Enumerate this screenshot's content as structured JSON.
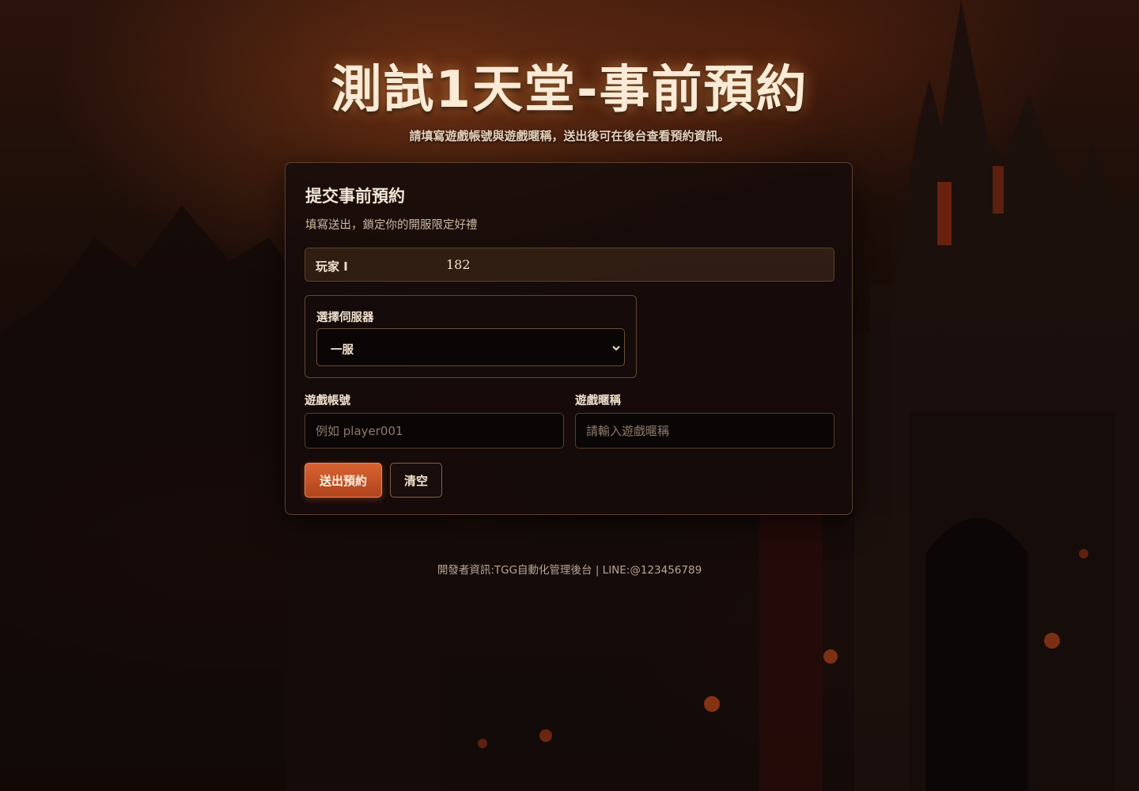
{
  "page": {
    "title": "測試1天堂-事前預約",
    "subtitle": "請填寫遊戲帳號與遊戲暱稱，送出後可在後台查看預約資訊。"
  },
  "card": {
    "title": "提交事前預約",
    "description": "填寫送出，鎖定你的開服限定好禮",
    "player": {
      "label": "玩家 I",
      "id": "182"
    },
    "server": {
      "label": "選擇伺服器",
      "selected": "一服"
    },
    "account": {
      "label": "遊戲帳號",
      "placeholder": "例如 player001",
      "value": ""
    },
    "nickname": {
      "label": "遊戲暱稱",
      "placeholder": "請輸入遊戲暱稱",
      "value": ""
    },
    "buttons": {
      "submit": "送出預約",
      "clear": "清空"
    }
  },
  "footer": {
    "text": "開發者資訊:TGG自動化管理後台 | LINE:@123456789"
  },
  "theme": {
    "accent": "#c9532a",
    "card_bg": "#160c0a",
    "text": "#f2e2cf"
  }
}
